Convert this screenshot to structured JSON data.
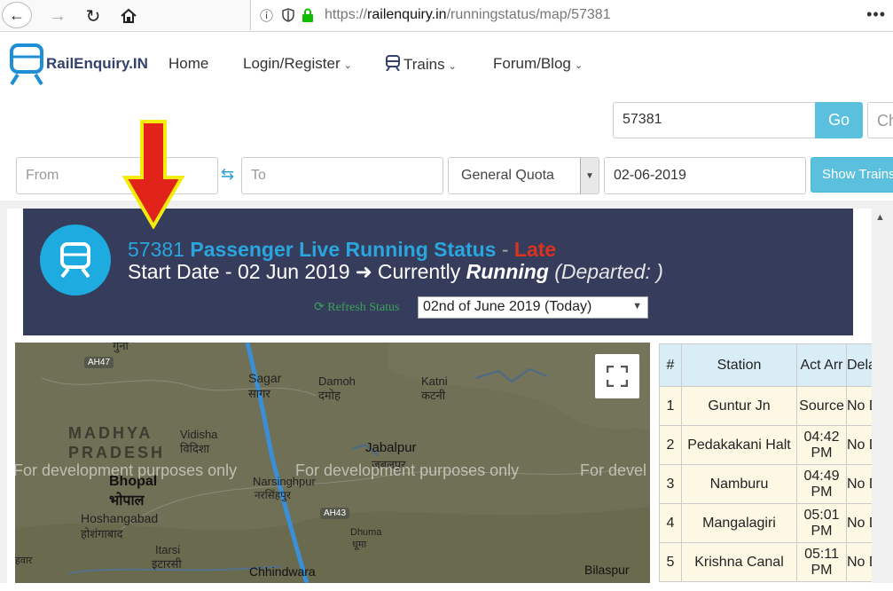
{
  "browser": {
    "url_prefix": "https://",
    "url_domain": "railenquiry.in",
    "url_path": "/runningstatus/map/57381"
  },
  "nav": {
    "logo_text": "RailEnquiry.IN",
    "home": "Home",
    "login": "Login/Register",
    "trains": "Trains",
    "forum": "Forum/Blog"
  },
  "search": {
    "train_value": "57381",
    "go_label": "Go",
    "ch_placeholder": "Ch",
    "from_placeholder": "From",
    "to_placeholder": "To",
    "quota": "General Quota",
    "date": "02-06-2019",
    "show_label": "Show Trains"
  },
  "banner": {
    "train_no": "57381",
    "title": "Passenger Live Running Status",
    "dash": "-",
    "status": "Late",
    "start_date": "Start Date - 02 Jun 2019",
    "currently": "Currently",
    "running": "Running",
    "departed": "(Departed: )",
    "refresh_label": "Refresh Status",
    "date_option": "02nd of June 2019 (Today)"
  },
  "map": {
    "fullscreen_icon": "fullscreen-icon",
    "colors": {
      "route": "#3a8fd6",
      "land": "#6f7055"
    },
    "labels": [
      {
        "text": "MADHYA"
      },
      {
        "text": "PRADESH"
      },
      {
        "text": "Bhopal"
      },
      {
        "text": "भोपाल"
      },
      {
        "text": "Vidisha"
      },
      {
        "text": "विदिशा"
      },
      {
        "text": "Sagar"
      },
      {
        "text": "सागर"
      },
      {
        "text": "Damoh"
      },
      {
        "text": "दमोह"
      },
      {
        "text": "Katni"
      },
      {
        "text": "कटनी"
      },
      {
        "text": "Jabalpur"
      },
      {
        "text": "जबलपुर"
      },
      {
        "text": "Narsinghpur"
      },
      {
        "text": "नरसिंहपुर"
      },
      {
        "text": "Hoshangabad"
      },
      {
        "text": "होशंगाबाद"
      },
      {
        "text": "Itarsi"
      },
      {
        "text": "इटारसी"
      },
      {
        "text": "Dhuma"
      },
      {
        "text": "धूमा"
      },
      {
        "text": "Chhindwara"
      },
      {
        "text": "Bilaspur"
      },
      {
        "text": "हवार"
      },
      {
        "text": "गुना"
      }
    ],
    "highways": [
      {
        "text": "AH47"
      },
      {
        "text": "AH43"
      }
    ],
    "watermarks": [
      {
        "text": "For development purposes only"
      },
      {
        "text": "For development purposes only"
      },
      {
        "text": "For devel"
      }
    ]
  },
  "table": {
    "headers": [
      "#",
      "Station",
      "Act Arr",
      "Dela Dep"
    ],
    "rows": [
      {
        "num": "1",
        "station": "Guntur Jn",
        "arr": "Source",
        "delay": "No Dela"
      },
      {
        "num": "2",
        "station": "Pedakakani Halt",
        "arr": "04:42 PM",
        "delay": "No Dela"
      },
      {
        "num": "3",
        "station": "Namburu",
        "arr": "04:49 PM",
        "delay": "No Dela"
      },
      {
        "num": "4",
        "station": "Mangalagiri",
        "arr": "05:01 PM",
        "delay": "No Dela"
      },
      {
        "num": "5",
        "station": "Krishna Canal",
        "arr": "05:11 PM",
        "delay": "No Dela"
      }
    ]
  }
}
